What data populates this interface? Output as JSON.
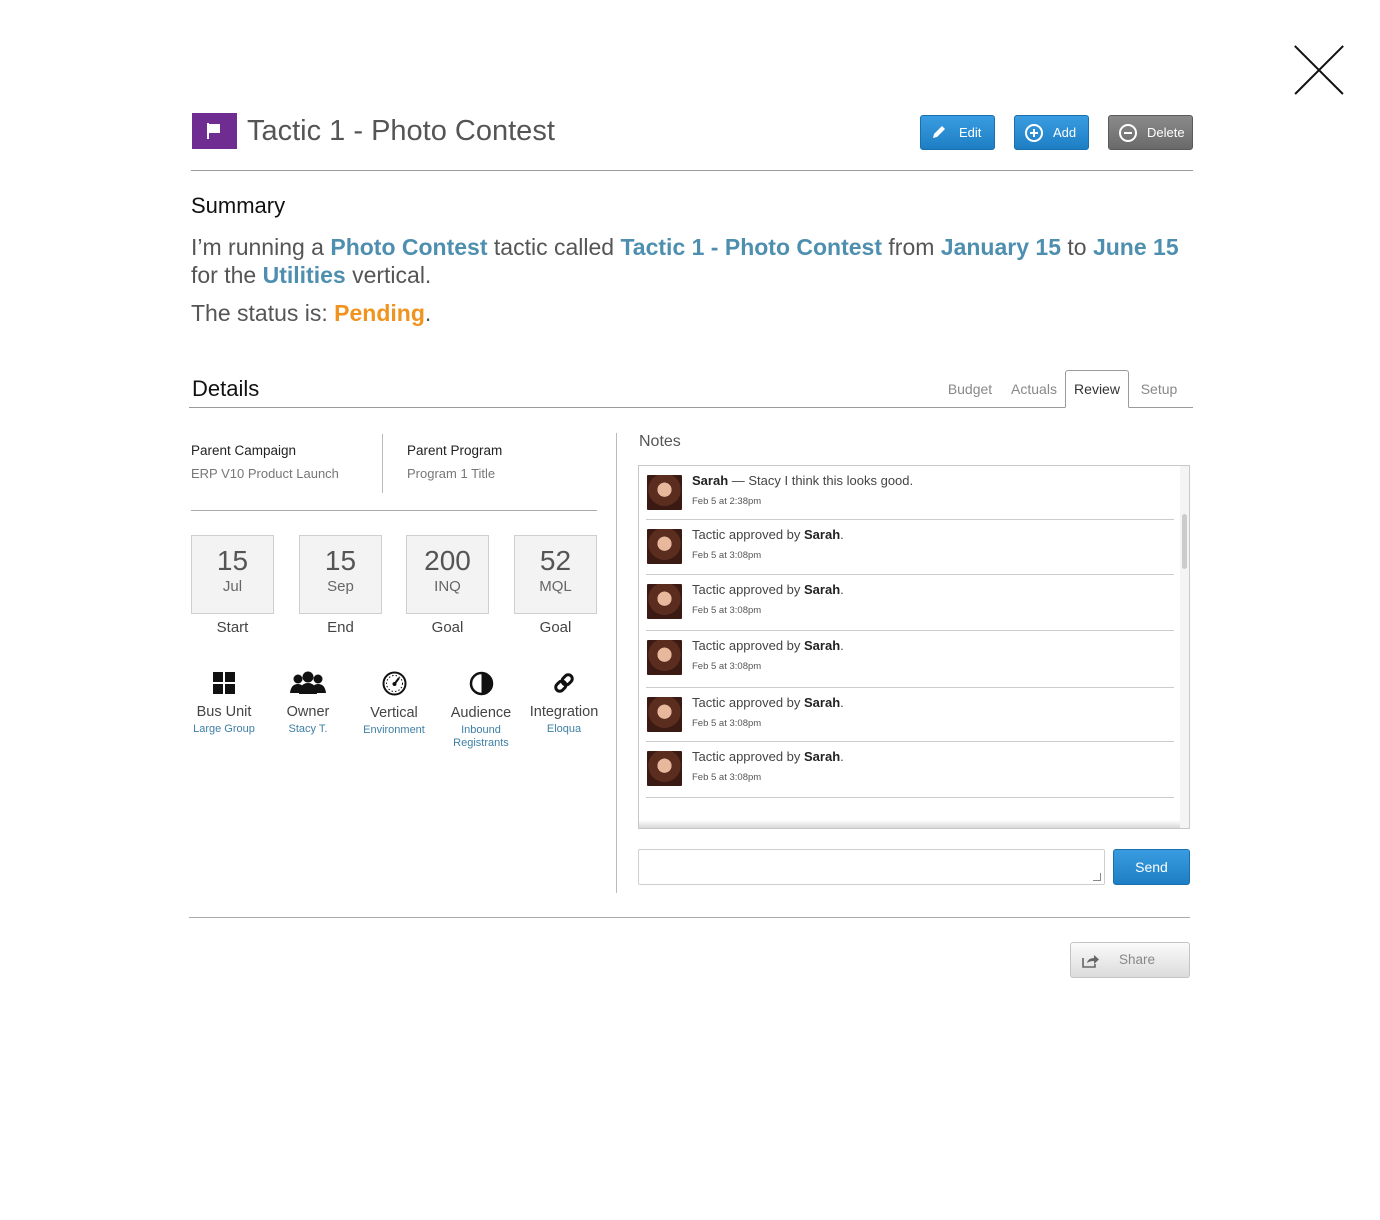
{
  "header": {
    "title": "Tactic 1 - Photo Contest",
    "edit_label": "Edit",
    "add_label": "Add",
    "delete_label": "Delete",
    "flag_color": "#6f2c91"
  },
  "summary": {
    "heading": "Summary",
    "p1": "I’m running a ",
    "tactic_type": "Photo Contest",
    "p2": " tactic called ",
    "tactic_name": "Tactic 1 - Photo Contest",
    "p3": " from ",
    "start": "January 15",
    "p4": " to ",
    "end": "June 15",
    "p5": " for the ",
    "vertical": "Utilities",
    "p6": " vertical.",
    "status_prefix": "The status is: ",
    "status": "Pending",
    "status_suffix": "."
  },
  "details": {
    "heading": "Details",
    "tabs": [
      {
        "label": "Budget"
      },
      {
        "label": "Actuals"
      },
      {
        "label": "Review",
        "active": true
      },
      {
        "label": "Setup"
      }
    ],
    "parent_campaign_label": "Parent Campaign",
    "parent_campaign_value": "ERP V10 Product Launch",
    "parent_program_label": "Parent Program",
    "parent_program_value": "Program 1 Title",
    "stats": [
      {
        "num": "15",
        "unit": "Jul",
        "caption": "Start"
      },
      {
        "num": "15",
        "unit": "Sep",
        "caption": "End"
      },
      {
        "num": "200",
        "unit": "INQ",
        "caption": "Goal"
      },
      {
        "num": "52",
        "unit": "MQL",
        "caption": "Goal"
      }
    ],
    "attributes": [
      {
        "name": "Bus Unit",
        "value": "Large Group",
        "icon": "grid-icon"
      },
      {
        "name": "Owner",
        "value": "Stacy T.",
        "icon": "people-icon"
      },
      {
        "name": "Vertical",
        "value": "Environment",
        "icon": "gauge-icon"
      },
      {
        "name": "Audience",
        "value": "Inbound Registrants",
        "icon": "contrast-icon"
      },
      {
        "name": "Integration",
        "value": "Eloqua",
        "icon": "link-icon"
      }
    ]
  },
  "notes": {
    "heading": "Notes",
    "items": [
      {
        "author": "Sarah",
        "text": " — Stacy I think this looks good.",
        "time": "Feb 5 at 2:38pm",
        "type": "comment"
      },
      {
        "prefix": "Tactic approved by ",
        "author": "Sarah",
        "suffix": ".",
        "time": "Feb 5 at 3:08pm",
        "type": "event"
      },
      {
        "prefix": "Tactic approved by ",
        "author": "Sarah",
        "suffix": ".",
        "time": "Feb 5 at 3:08pm",
        "type": "event"
      },
      {
        "prefix": "Tactic approved by ",
        "author": "Sarah",
        "suffix": ".",
        "time": "Feb 5 at 3:08pm",
        "type": "event"
      },
      {
        "prefix": "Tactic approved by ",
        "author": "Sarah",
        "suffix": ".",
        "time": "Feb 5 at 3:08pm",
        "type": "event"
      },
      {
        "prefix": "Tactic approved by ",
        "author": "Sarah",
        "suffix": ".",
        "time": "Feb 5 at 3:08pm",
        "type": "event"
      }
    ],
    "input_value": "",
    "send_label": "Send"
  },
  "footer": {
    "share_label": "Share"
  }
}
